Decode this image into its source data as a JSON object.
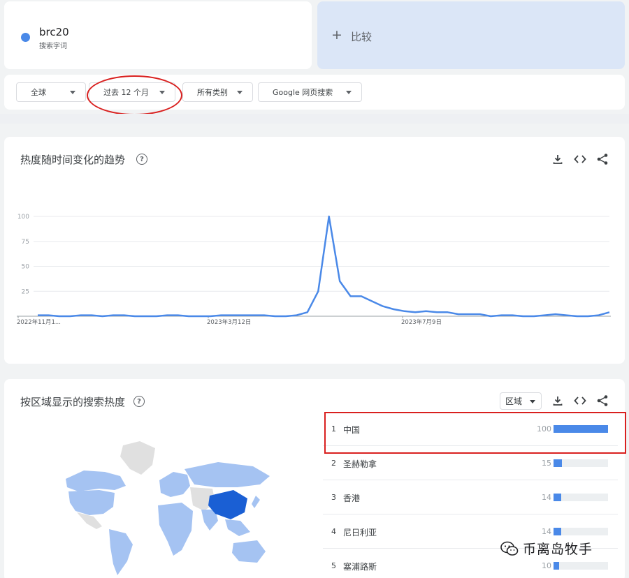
{
  "term": {
    "name": "brc20",
    "subtitle": "搜索字词",
    "color": "#4a89e8"
  },
  "compare": {
    "label": "比较",
    "icon": "plus-icon"
  },
  "filters": {
    "region": "全球",
    "time": "过去 12 个月",
    "category": "所有类别",
    "search_type": "Google 网页搜索"
  },
  "trend": {
    "title": "热度随时间变化的趋势",
    "help_icon": "?",
    "tools": [
      "download-icon",
      "embed-icon",
      "share-icon"
    ]
  },
  "chart_data": {
    "type": "line",
    "title": "",
    "xlabel": "",
    "ylabel": "",
    "ylim": [
      0,
      100
    ],
    "y_ticks": [
      "100",
      "75",
      "50",
      "25"
    ],
    "x_tick_labels": [
      "2022年11月1...",
      "2023年3月12日",
      "2023年7月9日"
    ],
    "grid": true,
    "series": [
      {
        "color": "#4a89e8",
        "values": [
          1,
          1,
          0,
          0,
          1,
          1,
          0,
          1,
          1,
          0,
          0,
          0,
          1,
          1,
          0,
          0,
          0,
          1,
          1,
          1,
          1,
          1,
          0,
          0,
          1,
          4,
          25,
          100,
          35,
          20,
          20,
          15,
          10,
          7,
          5,
          4,
          5,
          4,
          4,
          2,
          2,
          2,
          0,
          1,
          1,
          0,
          0,
          1,
          2,
          1,
          0,
          0,
          1,
          4
        ]
      }
    ]
  },
  "region": {
    "title": "按区域显示的搜索热度",
    "help_icon": "?",
    "select_label": "区域",
    "rows": [
      {
        "rank": "1",
        "name": "中国",
        "value": "100",
        "level": 100
      },
      {
        "rank": "2",
        "name": "圣赫勒拿",
        "value": "15",
        "level": 15
      },
      {
        "rank": "3",
        "name": "香港",
        "value": "14",
        "level": 14
      },
      {
        "rank": "4",
        "name": "尼日利亚",
        "value": "14",
        "level": 14
      },
      {
        "rank": "5",
        "name": "塞浦路斯",
        "value": "10",
        "level": 10
      }
    ]
  },
  "watermark": {
    "text": "币离岛牧手",
    "icon": "wechat-icon"
  },
  "colors": {
    "accent": "#4a89e8",
    "highlight": "#d9201f",
    "map_strong": "#1a5fd4",
    "map_light": "#a5c3f2",
    "map_none": "#e0e0e0"
  }
}
